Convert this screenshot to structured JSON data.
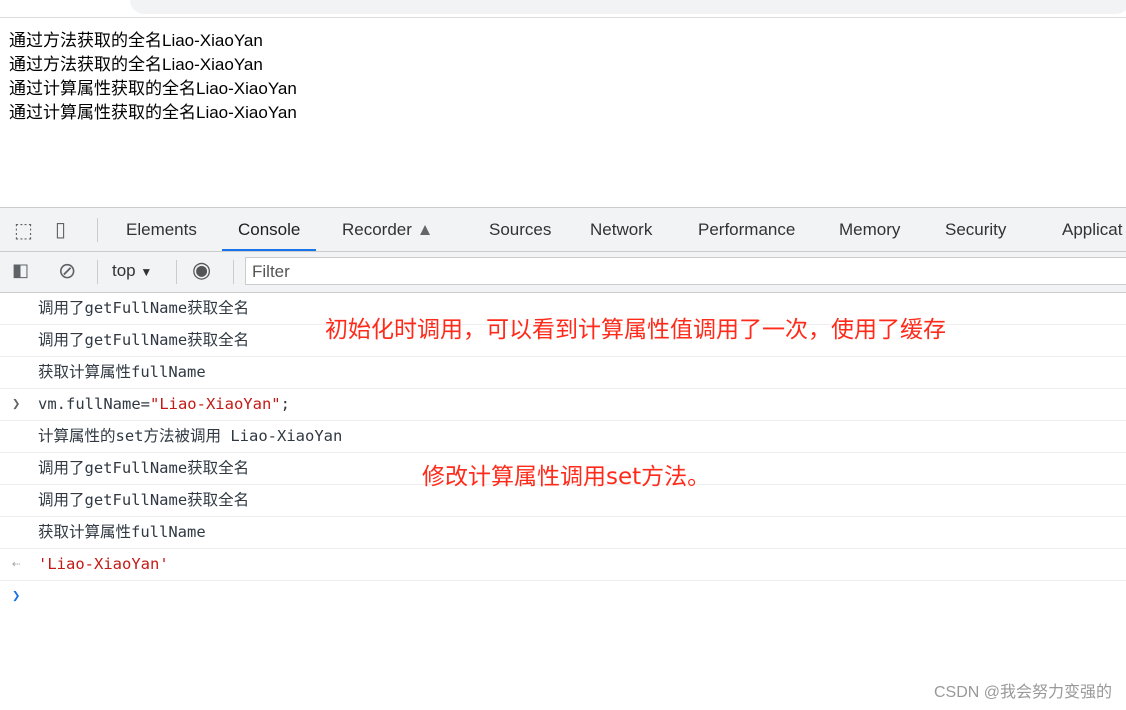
{
  "page": {
    "lines": [
      "通过方法获取的全名Liao-XiaoYan",
      "通过方法获取的全名Liao-XiaoYan",
      "通过计算属性获取的全名Liao-XiaoYan",
      "通过计算属性获取的全名Liao-XiaoYan"
    ]
  },
  "devtools": {
    "tabs": [
      "Elements",
      "Console",
      "Recorder",
      "Sources",
      "Network",
      "Performance",
      "Memory",
      "Security",
      "Applicat"
    ],
    "active_tab": "Console",
    "context": "top",
    "filter_placeholder": "Filter"
  },
  "console": {
    "lines": [
      "调用了getFullName获取全名",
      "调用了getFullName获取全名",
      "获取计算属性fullName",
      "vm.fullName=",
      "\"Liao-XiaoYan\"",
      ";",
      "计算属性的set方法被调用 Liao-XiaoYan",
      "调用了getFullName获取全名",
      "调用了getFullName获取全名",
      "获取计算属性fullName",
      "'Liao-XiaoYan'"
    ]
  },
  "annotations": [
    "初始化时调用，可以看到计算属性值调用了一次，使用了缓存",
    "修改计算属性调用set方法。"
  ],
  "watermark": "CSDN @我会努力变强的",
  "colors": {
    "accent": "#1a73e8",
    "annotation": "#ff2a1a",
    "string": "#c41a16"
  }
}
